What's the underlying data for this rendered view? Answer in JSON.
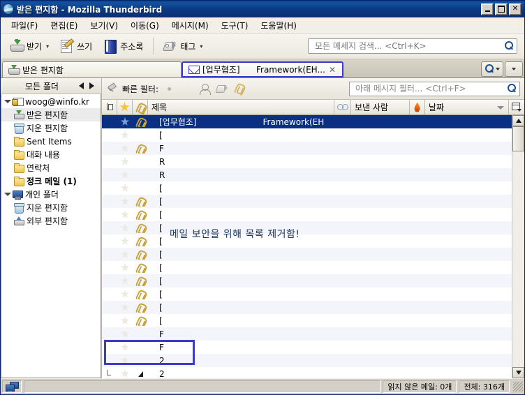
{
  "window": {
    "title_doc": "받은 편지함",
    "title_app": "Mozilla Thunderbird",
    "title_full": "받은 편지함 - Mozilla Thunderbird",
    "icon": "thunderbird-icon",
    "buttons": {
      "minimize": "_",
      "maximize": "□",
      "close": "✕"
    }
  },
  "menubar": {
    "items": [
      {
        "label": "파일(F)",
        "name": "menu-file"
      },
      {
        "label": "편집(E)",
        "name": "menu-edit"
      },
      {
        "label": "보기(V)",
        "name": "menu-view"
      },
      {
        "label": "이동(G)",
        "name": "menu-go"
      },
      {
        "label": "메시지(M)",
        "name": "menu-message"
      },
      {
        "label": "도구(T)",
        "name": "menu-tools"
      },
      {
        "label": "도움말(H)",
        "name": "menu-help"
      }
    ]
  },
  "toolbar": {
    "get_mail": "받기",
    "write": "쓰기",
    "address_book": "주소록",
    "tag": "태그",
    "search_placeholder": "모든 메세지 검색... <Ctrl+K>",
    "search_value": ""
  },
  "tabs": [
    {
      "label": "받은 편지함",
      "icon": "inbox-icon",
      "active": false
    },
    {
      "label": "[업무협조]",
      "label2": "Framework(EH...",
      "icon": "envelope-icon",
      "active": true,
      "close": "✕"
    }
  ],
  "tabbar_right": {
    "search_button": "search-dropdown",
    "list_all": "list-all-tabs"
  },
  "folder_pane": {
    "header": "모든 폴더",
    "nav_back": "◀",
    "nav_forward": "▶",
    "items": [
      {
        "label": "woog@winfo.kr",
        "icon": "account-icon",
        "indent": 0,
        "twisty": true,
        "selected": false,
        "bold": false
      },
      {
        "label": "받은 편지함",
        "icon": "inbox-icon",
        "indent": 1,
        "twisty": false,
        "selected": true,
        "bold": false
      },
      {
        "label": "지운 편지함",
        "icon": "trash-icon",
        "indent": 1,
        "twisty": false,
        "selected": false,
        "bold": false
      },
      {
        "label": "Sent Items",
        "icon": "folder-icon",
        "indent": 1,
        "twisty": false,
        "selected": false,
        "bold": false
      },
      {
        "label": "대화 내용",
        "icon": "folder-icon",
        "indent": 1,
        "twisty": false,
        "selected": false,
        "bold": false
      },
      {
        "label": "연락처",
        "icon": "folder-icon",
        "indent": 1,
        "twisty": false,
        "selected": false,
        "bold": false
      },
      {
        "label": "정크 메일 (1)",
        "icon": "folder-icon",
        "indent": 1,
        "twisty": false,
        "selected": false,
        "bold": true
      },
      {
        "label": "개인 폴더",
        "icon": "local-folders-icon",
        "indent": 0,
        "twisty": true,
        "selected": false,
        "bold": false
      },
      {
        "label": "지운 편지함",
        "icon": "trash-icon",
        "indent": 1,
        "twisty": false,
        "selected": false,
        "bold": false
      },
      {
        "label": "외부 편지함",
        "icon": "outbox-icon",
        "indent": 1,
        "twisty": false,
        "selected": false,
        "bold": false
      }
    ]
  },
  "quick_filter": {
    "pin_icon": "pin-icon",
    "label": "빠른 필터:",
    "buttons": [
      {
        "name": "filter-unread",
        "icon": "unread-dot-icon"
      },
      {
        "name": "filter-starred",
        "icon": "star-icon"
      },
      {
        "name": "filter-contact",
        "icon": "person-icon"
      },
      {
        "name": "filter-tag",
        "icon": "tag-icon"
      },
      {
        "name": "filter-attachment",
        "icon": "attachment-icon"
      }
    ],
    "input_placeholder": "아래 메시지 필터... <Ctrl+F>",
    "input_value": ""
  },
  "columns": [
    {
      "name": "thread",
      "label": "",
      "icon": "thread-icon"
    },
    {
      "name": "star",
      "label": "",
      "icon": "star-icon"
    },
    {
      "name": "attachment",
      "label": "",
      "icon": "attachment-icon"
    },
    {
      "name": "subject",
      "label": "제목",
      "icon": ""
    },
    {
      "name": "read",
      "label": "",
      "icon": "read-status-icon"
    },
    {
      "name": "sender",
      "label": "보낸 사람",
      "icon": ""
    },
    {
      "name": "junk",
      "label": "",
      "icon": "junk-flame-icon"
    },
    {
      "name": "date",
      "label": "날짜",
      "icon": "",
      "sorted": true
    },
    {
      "name": "column-picker",
      "label": "",
      "icon": "column-picker-icon"
    }
  ],
  "message_list": {
    "overlay_note": "메일 보안을 위해 목록 제거함!",
    "rows": [
      {
        "selected": true,
        "star": true,
        "attachment": true,
        "subject": "[업무협조]",
        "subject2": "Framework(EH"
      },
      {
        "selected": false,
        "star": false,
        "attachment": false,
        "subject": "[",
        "subject2": ""
      },
      {
        "selected": false,
        "star": false,
        "attachment": true,
        "subject": "F",
        "subject2": ""
      },
      {
        "selected": false,
        "star": false,
        "attachment": false,
        "subject": "R",
        "subject2": ""
      },
      {
        "selected": false,
        "star": false,
        "attachment": false,
        "subject": "R",
        "subject2": ""
      },
      {
        "selected": false,
        "star": false,
        "attachment": false,
        "subject": "[",
        "subject2": ""
      },
      {
        "selected": false,
        "star": false,
        "attachment": true,
        "subject": "[",
        "subject2": ""
      },
      {
        "selected": false,
        "star": false,
        "attachment": true,
        "subject": "[",
        "subject2": ""
      },
      {
        "selected": false,
        "star": false,
        "attachment": true,
        "subject": "[",
        "subject2": ""
      },
      {
        "selected": false,
        "star": false,
        "attachment": true,
        "subject": "[",
        "subject2": ""
      },
      {
        "selected": false,
        "star": false,
        "attachment": true,
        "subject": "[",
        "subject2": ""
      },
      {
        "selected": false,
        "star": false,
        "attachment": true,
        "subject": "[",
        "subject2": ""
      },
      {
        "selected": false,
        "star": false,
        "attachment": true,
        "subject": "[",
        "subject2": ""
      },
      {
        "selected": false,
        "star": false,
        "attachment": true,
        "subject": "[",
        "subject2": ""
      },
      {
        "selected": false,
        "star": false,
        "attachment": true,
        "subject": "[",
        "subject2": ""
      },
      {
        "selected": false,
        "star": false,
        "attachment": true,
        "subject": "[",
        "subject2": ""
      },
      {
        "selected": false,
        "star": false,
        "attachment": false,
        "subject": "F",
        "subject2": ""
      },
      {
        "selected": false,
        "star": false,
        "attachment": false,
        "subject": "F",
        "subject2": ""
      },
      {
        "selected": false,
        "star": false,
        "attachment": false,
        "subject": "2",
        "subject2": ""
      },
      {
        "selected": false,
        "star": false,
        "attachment": false,
        "subject": "2",
        "subject2": "",
        "thread": true,
        "twisty": true
      },
      {
        "selected": false,
        "star": false,
        "attachment": false,
        "subject": "",
        "subject2": "",
        "dots": true
      }
    ]
  },
  "scrollbar": {
    "up": "▲",
    "down": "▼",
    "name": "message-list-scrollbar"
  },
  "statusbar": {
    "icon": "network-status-icon",
    "message": "",
    "unread": "읽지 않은 메일: 0개",
    "total": "전체: 316개"
  },
  "colors": {
    "titlebar": "#0a3f8f",
    "selection": "#0b2f82",
    "annotation": "#3b3bc8",
    "note_text": "#17365d",
    "chrome": "#d4d0c8"
  }
}
